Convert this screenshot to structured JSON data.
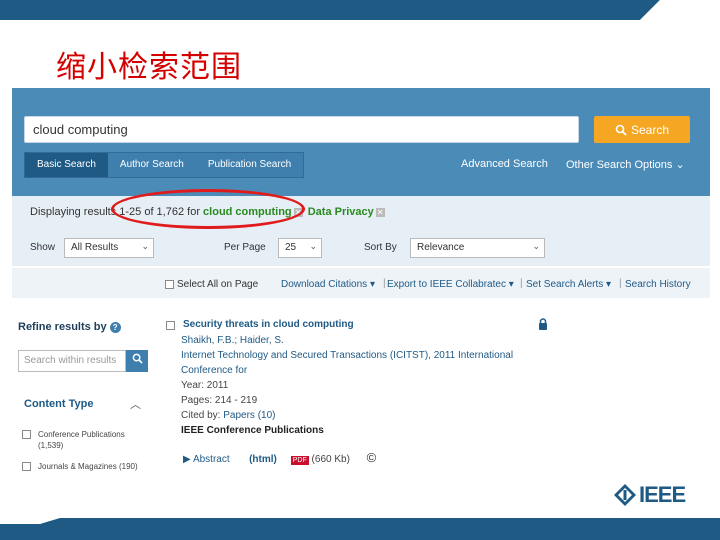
{
  "slide": {
    "title": "缩小检索范围",
    "logo_text": "IEEE"
  },
  "search": {
    "value": "cloud computing",
    "button_label": "Search"
  },
  "tabs": [
    {
      "label": "Basic Search"
    },
    {
      "label": "Author Search"
    },
    {
      "label": "Publication Search"
    }
  ],
  "links": {
    "advanced": "Advanced Search",
    "other": "Other Search Options"
  },
  "results_info": {
    "prefix": "Displaying results 1-25 of 1,762 for",
    "term1": "cloud computing",
    "term2": "Data Privacy"
  },
  "controls": {
    "show_label": "Show",
    "show_value": "All Results",
    "per_page_label": "Per Page",
    "per_page_value": "25",
    "sort_label": "Sort By",
    "sort_value": "Relevance"
  },
  "bulk_bar": {
    "select_all": "Select All on Page",
    "download": "Download Citations",
    "export": "Export to IEEE Collabratec",
    "alerts": "Set Search Alerts",
    "history": "Search History"
  },
  "sidebar": {
    "refine_label": "Refine results by",
    "within_placeholder": "Search within results",
    "content_type_title": "Content Type",
    "content_types": [
      {
        "label": "Conference Publications",
        "count": "(1,539)"
      },
      {
        "label": "Journals & Magazines",
        "count": "(190)"
      }
    ]
  },
  "result": {
    "title": "Security threats in cloud computing",
    "authors": "Shaikh, F.B.; Haider, S.",
    "venue_1": "Internet Technology and Secured Transactions (ICITST), 2011 International",
    "venue_2": "Conference for",
    "year": "Year: 2011",
    "pages": "Pages: 214 - 219",
    "cited_by_prefix": "Cited by:",
    "cited_by_link": "Papers (10)",
    "publisher": "IEEE Conference Publications",
    "abstract": "Abstract",
    "html": "(html)",
    "size": "(660 Kb)"
  },
  "colors": {
    "ieee_blue": "#4a8bb8",
    "dark_blue": "#1f5a85",
    "search_orange": "#f5a623",
    "highlight_red": "#e01b1b",
    "term_green": "#2a8a1f"
  }
}
